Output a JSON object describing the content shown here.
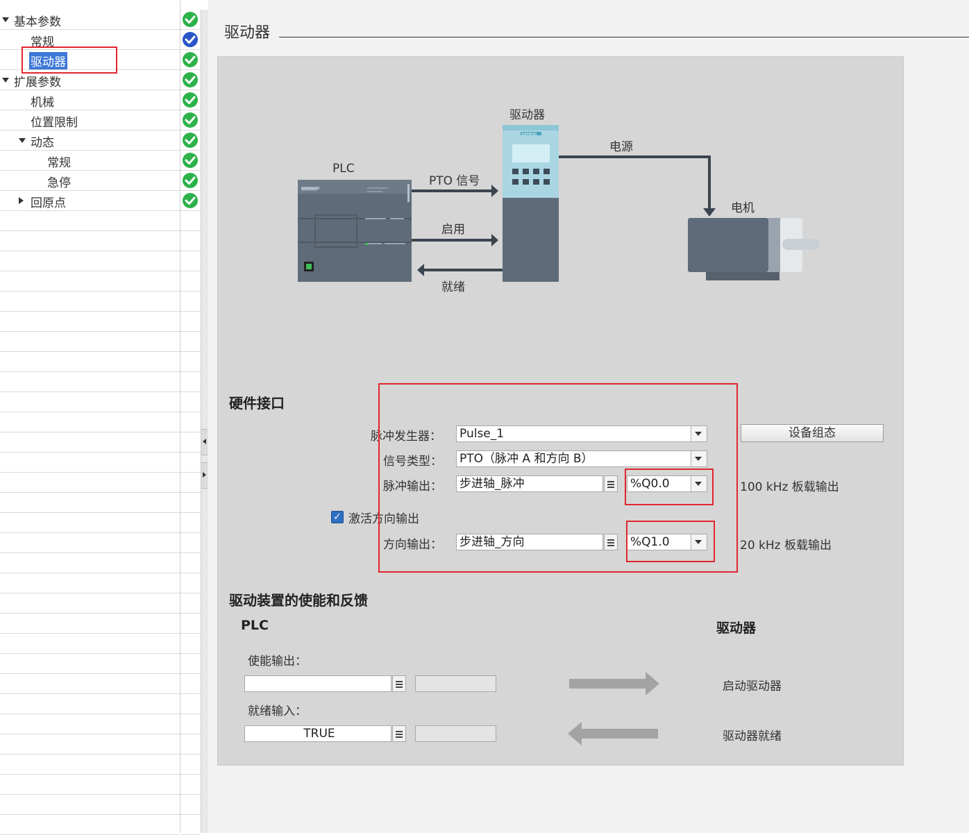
{
  "tree": {
    "items": [
      {
        "label": "基本参数",
        "level": 0,
        "expander": "down",
        "status": "ok"
      },
      {
        "label": "常规",
        "level": 1,
        "expander": "none",
        "status": "info"
      },
      {
        "label": "驱动器",
        "level": 1,
        "expander": "none",
        "status": "ok",
        "selected": true
      },
      {
        "label": "扩展参数",
        "level": 0,
        "expander": "down",
        "status": "ok"
      },
      {
        "label": "机械",
        "level": 1,
        "expander": "none",
        "status": "ok"
      },
      {
        "label": "位置限制",
        "level": 1,
        "expander": "none",
        "status": "ok"
      },
      {
        "label": "动态",
        "level": 1,
        "expander": "down",
        "status": "ok"
      },
      {
        "label": "常规",
        "level": 2,
        "expander": "none",
        "status": "ok"
      },
      {
        "label": "急停",
        "level": 2,
        "expander": "none",
        "status": "ok"
      },
      {
        "label": "回原点",
        "level": 1,
        "expander": "right",
        "status": "ok"
      }
    ]
  },
  "page": {
    "title": "驱动器"
  },
  "diagram": {
    "plc_label": "PLC",
    "drive_label": "驱动器",
    "power_label": "电源",
    "motor_label": "电机",
    "pto_label": "PTO 信号",
    "enable_label": "启用",
    "ready_label": "就绪",
    "brand": "SIEMENS"
  },
  "hw": {
    "title": "硬件接口",
    "pulse_gen_label": "脉冲发生器：",
    "pulse_gen_value": "Pulse_1",
    "device_config_button": "设备组态",
    "signal_type_label": "信号类型：",
    "signal_type_value": "PTO（脉冲 A 和方向 B）",
    "pulse_out_label": "脉冲输出：",
    "pulse_out_tag": "步进轴_脉冲",
    "pulse_out_addr": "%Q0.0",
    "pulse_out_note": "100 kHz 板载输出",
    "activate_dir_label": "激活方向输出",
    "activate_dir_checked": true,
    "dir_out_label": "方向输出：",
    "dir_out_tag": "步进轴_方向",
    "dir_out_addr": "%Q1.0",
    "dir_out_note": "20 kHz 板载输出"
  },
  "enable": {
    "title": "驱动装置的使能和反馈",
    "plc_header": "PLC",
    "drive_header": "驱动器",
    "enable_out_label": "使能输出：",
    "enable_out_value": "",
    "ready_in_label": "就绪输入：",
    "ready_in_value": "TRUE",
    "start_drive_label": "启动驱动器",
    "drive_ready_label": "驱动器就绪"
  },
  "colors": {
    "ok": "#2db24a",
    "info": "#2a55c8",
    "highlight": "#e0262e",
    "selection": "#3d78d6"
  }
}
